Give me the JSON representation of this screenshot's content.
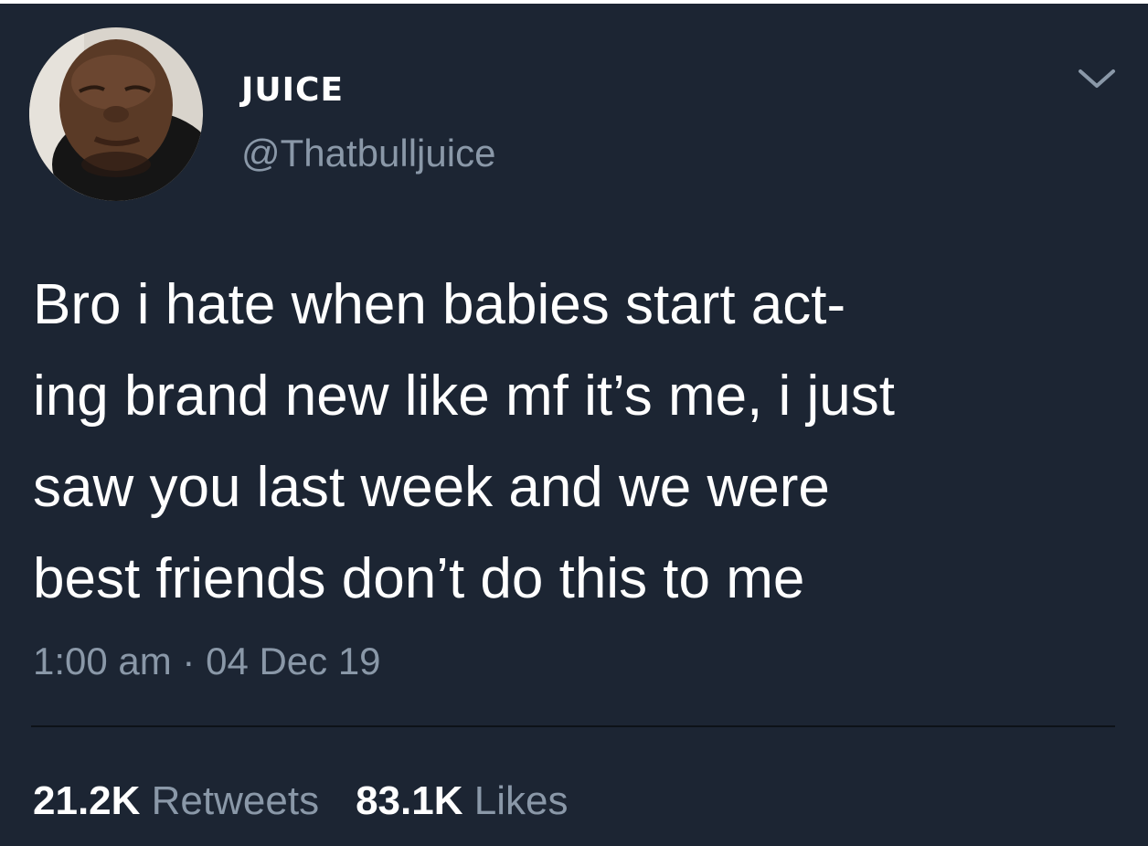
{
  "user": {
    "display_name": "JUICE",
    "handle": "@Thatbulljuice"
  },
  "tweet": {
    "lines": [
      "Bro i hate when babies start act-",
      "ing brand new like mf it’s me, i just",
      "saw you last week and we were",
      "best friends don’t do this to me"
    ],
    "timestamp": "1:00 am · 04 Dec 19"
  },
  "stats": {
    "retweets_count": "21.2K",
    "retweets_label": "Retweets",
    "likes_count": "83.1K",
    "likes_label": "Likes"
  },
  "icons": {
    "menu": "chevron-down-icon",
    "avatar": "profile-photo"
  },
  "colors": {
    "background": "#1c2533",
    "primary_text": "#ffffff",
    "secondary_text": "#8a98a8",
    "divider": "#0d1218"
  }
}
